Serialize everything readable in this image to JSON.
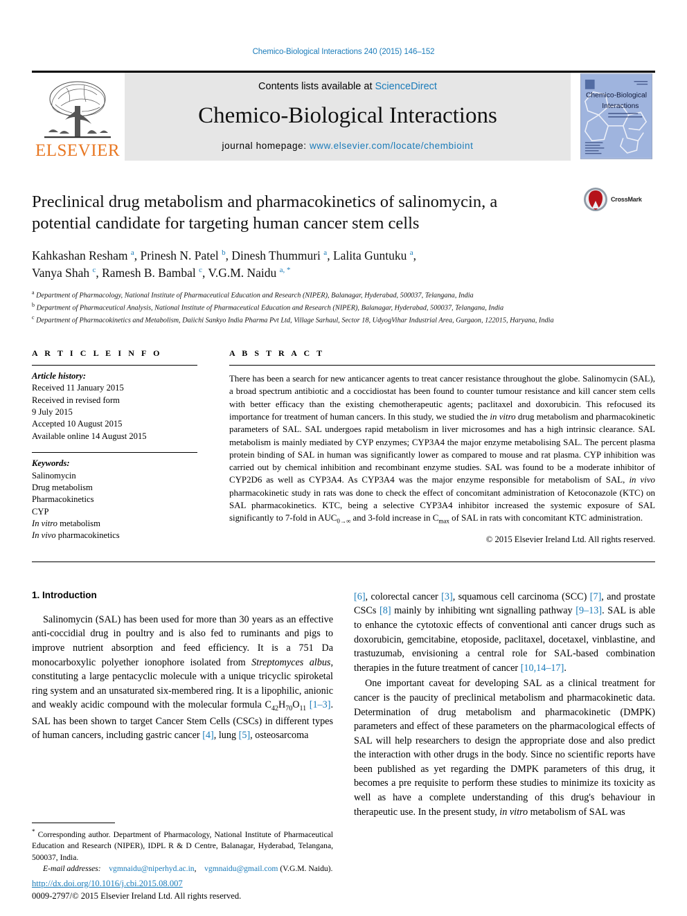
{
  "running_head": "Chemico-Biological Interactions 240 (2015) 146–152",
  "masthead": {
    "contents_prefix": "Contents lists available at ",
    "sciencedirect": "ScienceDirect",
    "journal_name": "Chemico-Biological Interactions",
    "homepage_prefix": "journal homepage: ",
    "homepage_url": "www.elsevier.com/locate/chembioint",
    "publisher_logo_text": "ELSEVIER",
    "cover_title_line1": "Chemico-Biological",
    "cover_title_line2": "Interactions",
    "accent_color": "#1a7bb9",
    "elsevier_orange": "#E87722"
  },
  "article": {
    "title": "Preclinical drug metabolism and pharmacokinetics of salinomycin, a potential candidate for targeting human cancer stem cells",
    "crossmark_label": "CrossMark",
    "authors_line1": "Kahkashan Resham <sup>a</sup>, Prinesh N. Patel <sup>b</sup>, Dinesh Thummuri <sup>a</sup>, Lalita Guntuku <sup>a</sup>,",
    "authors_line2": "Vanya Shah <sup>c</sup>, Ramesh B. Bambal <sup>c</sup>, V.G.M. Naidu <sup>a, *</sup>",
    "affiliations": [
      {
        "marker": "a",
        "text": "Department of Pharmacology, National Institute of Pharmaceutical Education and Research (NIPER), Balanagar, Hyderabad, 500037, Telangana, India"
      },
      {
        "marker": "b",
        "text": "Department of Pharmaceutical Analysis, National Institute of Pharmaceutical Education and Research (NIPER), Balanagar, Hyderabad, 500037, Telangana, India"
      },
      {
        "marker": "c",
        "text": "Department of Pharmacokinetics and Metabolism, Daiichi Sankyo India Pharma Pvt Ltd, Village Sarhaul, Sector 18, UdyogVihar Industrial Area, Gurgaon, 122015, Haryana, India"
      }
    ]
  },
  "article_info": {
    "heading": "A R T I C L E   I N F O",
    "history_label": "Article history:",
    "history": [
      "Received 11 January 2015",
      "Received in revised form",
      "9 July 2015",
      "Accepted 10 August 2015",
      "Available online 14 August 2015"
    ],
    "keywords_label": "Keywords:",
    "keywords": [
      {
        "text": "Salinomycin",
        "italic": false
      },
      {
        "text": "Drug metabolism",
        "italic": false
      },
      {
        "text": "Pharmacokinetics",
        "italic": false
      },
      {
        "text": "CYP",
        "italic": false
      },
      {
        "text": "In vitro metabolism",
        "italic": true,
        "italic_part": "In vitro",
        "roman_part": " metabolism"
      },
      {
        "text": "In vivo pharmacokinetics",
        "italic": true,
        "italic_part": "In vivo",
        "roman_part": " pharmacokinetics"
      }
    ]
  },
  "abstract": {
    "heading": "A B S T R A C T",
    "text_html": "There has been a search for new anticancer agents to treat cancer resistance throughout the globe. Salinomycin (SAL), a broad spectrum antibiotic and a coccidiostat has been found to counter tumour resistance and kill cancer stem cells with better efficacy than the existing chemotherapeutic agents; paclitaxel and doxorubicin. This refocused its importance for treatment of human cancers. In this study, we studied the <i>in vitro</i> drug metabolism and pharmacokinetic parameters of SAL. SAL undergoes rapid metabolism in liver microsomes and has a high intrinsic clearance. SAL metabolism is mainly mediated by CYP enzymes; CYP3A4 the major enzyme metabolising SAL. The percent plasma protein binding of SAL in human was significantly lower as compared to mouse and rat plasma. CYP inhibition was carried out by chemical inhibition and recombinant enzyme studies. SAL was found to be a moderate inhibitor of CYP2D6 as well as CYP3A4. As CYP3A4 was the major enzyme responsible for metabolism of SAL, <i>in vivo</i> pharmacokinetic study in rats was done to check the effect of concomitant administration of Ketoconazole (KTC) on SAL pharmacokinetics. KTC, being a selective CYP3A4 inhibitor increased the systemic exposure of SAL significantly to 7-fold in AUC<sub>0&#8594;&#8734;</sub> and 3-fold increase in C<sub>max</sub> of SAL in rats with concomitant KTC administration.",
    "copyright": "© 2015 Elsevier Ireland Ltd. All rights reserved."
  },
  "body": {
    "section_heading": "1. Introduction",
    "left_paragraphs": [
      "Salinomycin (SAL) has been used for more than 30 years as an effective anti-coccidial drug in poultry and is also fed to ruminants and pigs to improve nutrient absorption and feed efficiency. It is a 751 Da monocarboxylic polyether ionophore isolated from <i>Streptomyces albus</i>, constituting a large pentacyclic molecule with a unique tricyclic spiroketal ring system and an unsaturated six-membered ring. It is a lipophilic, anionic and weakly acidic compound with the molecular formula C<sub>42</sub>H<sub>70</sub>O<sub>11</sub> <span class=\"ref\">[1&#8211;3]</span>. SAL has been shown to target Cancer Stem Cells (CSCs) in different types of human cancers, including gastric cancer <span class=\"ref\">[4]</span>, lung <span class=\"ref\">[5]</span>, osteosarcoma"
    ],
    "right_paragraphs": [
      "<span class=\"ref\">[6]</span>, colorectal cancer <span class=\"ref\">[3]</span>, squamous cell carcinoma (SCC) <span class=\"ref\">[7]</span>, and prostate CSCs <span class=\"ref\">[8]</span> mainly by inhibiting wnt signalling pathway <span class=\"ref\">[9&#8211;13]</span>. SAL is able to enhance the cytotoxic effects of conventional anti cancer drugs such as doxorubicin, gemcitabine, etoposide, paclitaxel, docetaxel, vinblastine, and trastuzumab, envisioning a central role for SAL-based combination therapies in the future treatment of cancer <span class=\"ref\">[10,14&#8211;17]</span>.",
      "One important caveat for developing SAL as a clinical treatment for cancer is the paucity of preclinical metabolism and pharmacokinetic data. Determination of drug metabolism and pharmacokinetic (DMPK) parameters and effect of these parameters on the pharmacological effects of SAL will help researchers to design the appropriate dose and also predict the interaction with other drugs in the body. Since no scientific reports have been published as yet regarding the DMPK parameters of this drug, it becomes a pre requisite to perform these studies to minimize its toxicity as well as have a complete understanding of this drug's behaviour in therapeutic use. In the present study, <i>in vitro</i> metabolism of SAL was"
    ]
  },
  "footnotes": {
    "corresponding_html": "<span class=\"star\">*</span> Corresponding author. Department of Pharmacology, National Institute of Pharmaceutical Education and Research (NIPER), IDPL R &amp; D Centre, Balanagar, Hyderabad, Telangana, 500037, India.",
    "email_label": "E-mail addresses:",
    "email1": "vgmnaidu@niperhyd.ac.in",
    "email2": "vgmnaidu@gmail.com",
    "email_owner": "(V.G.M. Naidu).",
    "doi_url": "http://dx.doi.org/10.1016/j.cbi.2015.08.007",
    "issn_line": "0009-2797/© 2015 Elsevier Ireland Ltd. All rights reserved."
  }
}
